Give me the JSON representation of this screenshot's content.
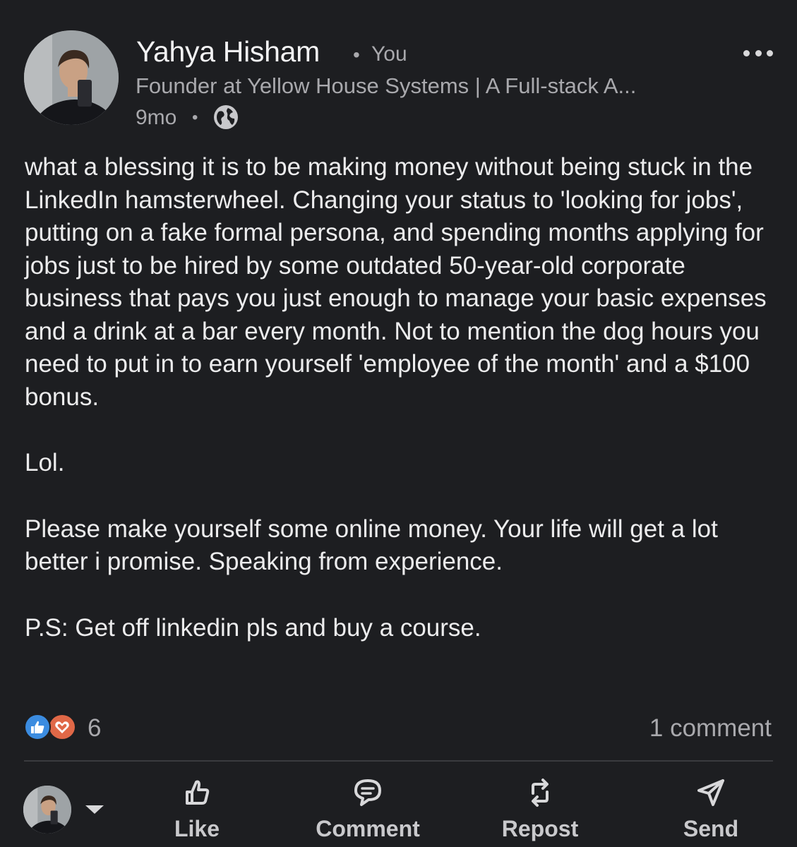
{
  "author": {
    "name": "Yahya Hisham",
    "relation": "You",
    "headline": "Founder at Yellow House Systems | A Full-stack A...",
    "timestamp": "9mo",
    "visibility_icon": "globe-icon"
  },
  "post": {
    "paragraphs": [
      "what a blessing it is to be making money without being stuck in the LinkedIn hamsterwheel. Changing your status to 'looking for jobs', putting on a fake formal persona, and spending months applying for jobs just to be hired by some outdated 50-year-old corporate business that pays you just enough to manage your basic expenses and a drink at a bar every month. Not to mention the dog hours you need to put in to earn yourself 'employee of the month' and a $100 bonus.",
      "Lol.",
      "Please make yourself some online money. Your life will get a lot better i promise. Speaking from experience.",
      "P.S: Get off linkedin pls and buy a course."
    ]
  },
  "social": {
    "reactions": [
      "like-reaction-icon",
      "love-reaction-icon"
    ],
    "reaction_count": "6",
    "comment_count": "1 comment"
  },
  "actions": {
    "like": "Like",
    "comment": "Comment",
    "repost": "Repost",
    "send": "Send"
  },
  "colors": {
    "background": "#1d1e21",
    "text_primary": "#ececed",
    "text_secondary": "#a9a9ad",
    "like_blue": "#3b8ce0",
    "love_red": "#e06847"
  }
}
